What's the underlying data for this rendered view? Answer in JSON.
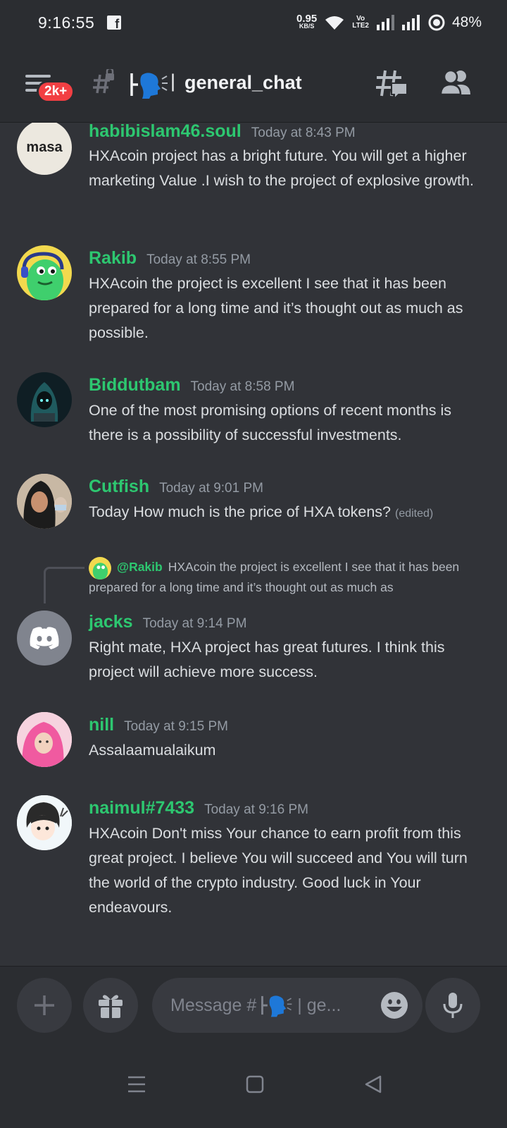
{
  "status_bar": {
    "time": "9:16:55",
    "speed_value": "0.95",
    "speed_unit": "KB/S",
    "volte_top": "Vo",
    "volte_bottom": "LTE2",
    "battery": "48%"
  },
  "header": {
    "badge": "2k+",
    "channel_name": "general_chat"
  },
  "messages": [
    {
      "username": "habibislam46.soul",
      "timestamp": "Today at 8:43 PM",
      "avatar_text": "masa",
      "text": "HXAcoin project has a bright future. You will get a higher marketing Value .I wish to the project of explosive growth."
    },
    {
      "username": "Rakib",
      "timestamp": "Today at 8:55 PM",
      "text": "HXAcoin the project is excellent I see that it has been prepared for a long time and it’s thought out as much as possible."
    },
    {
      "username": "Biddutbam",
      "timestamp": "Today at 8:58 PM",
      "text": "One of the most promising options of recent months is there is a possibility of successful investments."
    },
    {
      "username": "Cutfish",
      "timestamp": "Today at 9:01 PM",
      "text": "Today How much is the price of HXA tokens?",
      "edited": "(edited)"
    },
    {
      "username": "jacks",
      "timestamp": "Today at 9:14 PM",
      "text": "Right mate, HXA project has great futures. I think this project will achieve more success.",
      "reply": {
        "mention": "@Rakib",
        "text": "HXAcoin the project is excellent I see that it has been prepared for a long time and it’s thought out as much as"
      }
    },
    {
      "username": "nill",
      "timestamp": "Today at 9:15 PM",
      "text": "Assalaamualaikum"
    },
    {
      "username": "naimul#7433",
      "timestamp": "Today at 9:16 PM",
      "text": "HXAcoin Don't miss Your chance to earn profit from this great project. I believe You will succeed and You will turn the world of the crypto industry. Good luck in Your endeavours."
    }
  ],
  "composer": {
    "placeholder_prefix": "Message #",
    "placeholder_suffix": "| ge..."
  },
  "colors": {
    "background": "#313338",
    "header_bg": "#2b2d31",
    "username": "#2dc770",
    "badge": "#f23f43"
  },
  "icons": [
    "facebook-icon",
    "wifi-icon",
    "signal-icon",
    "battery-icon",
    "menu-icon",
    "locked-hash-icon",
    "speaking-head-icon",
    "threads-icon",
    "members-icon",
    "plus-icon",
    "gift-icon",
    "emoji-icon",
    "mic-icon",
    "nav-menu-icon",
    "nav-home-icon",
    "nav-back-icon"
  ]
}
